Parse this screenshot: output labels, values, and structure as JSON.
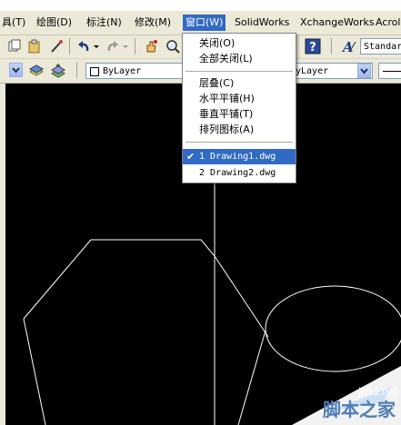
{
  "menubar": {
    "items": [
      "具(T)",
      "绘图(D)",
      "标注(N)",
      "修改(M)",
      "窗口(W)",
      "SolidWorks",
      "XchangeWorks",
      "Acrol"
    ]
  },
  "toolbar": {
    "layer_combo": "ByLayer",
    "layer_combo_right": "yLayer",
    "text_style": "Standar"
  },
  "window_menu": {
    "items": [
      "关闭(O)",
      "全部关闭(L)",
      "层叠(C)",
      "水平平铺(H)",
      "垂直平铺(T)",
      "排列图标(A)"
    ],
    "documents": [
      "1 Drawing1.dwg",
      "2 Drawing2.dwg"
    ],
    "check_mark": "✔"
  },
  "watermark": {
    "url": "jb51.net",
    "text": "脚本之家"
  },
  "colors": {
    "menu_highlight": "#316ac5",
    "canvas_bg": "#000000",
    "line_color": "#ffffff",
    "toolbar_bg": "#ece9d8"
  }
}
